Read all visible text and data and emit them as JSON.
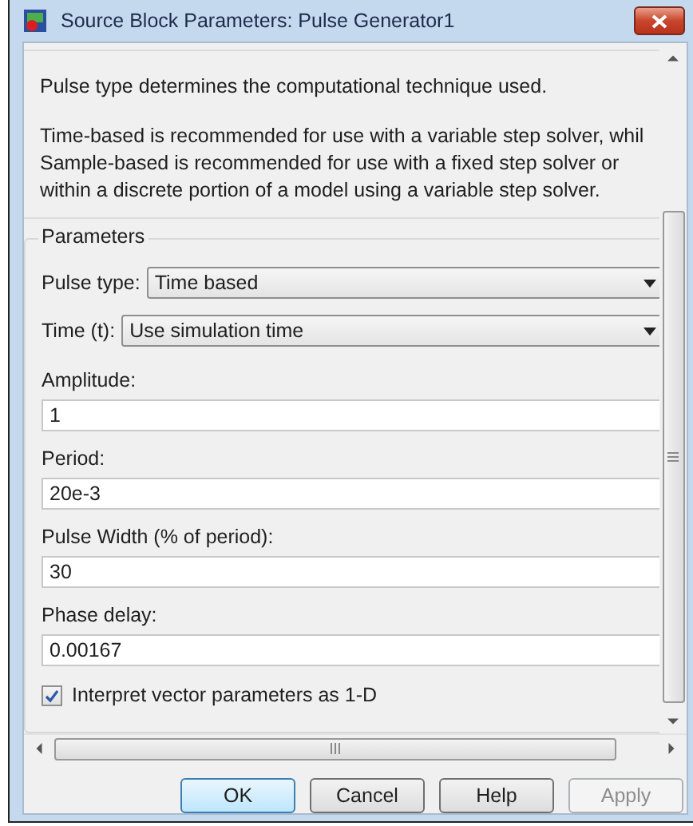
{
  "window": {
    "title": "Source Block Parameters: Pulse Generator1"
  },
  "description": [
    "Pulse type determines the computational technique used.",
    "Time-based is recommended for use with a variable step solver, whil\nSample-based is recommended for use with a fixed step solver or\nwithin a discrete portion of a model using a variable step solver."
  ],
  "parameters": {
    "title": "Parameters",
    "items": [
      {
        "kind": "select",
        "label": "Pulse type:",
        "value": "Time based"
      },
      {
        "kind": "select",
        "label": "Time (t):",
        "value": "Use simulation time"
      },
      {
        "kind": "text",
        "label": "Amplitude:",
        "value": "1"
      },
      {
        "kind": "text",
        "label": "Period:",
        "value": "20e-3"
      },
      {
        "kind": "text",
        "label": "Pulse Width (% of period):",
        "value": "30"
      },
      {
        "kind": "text",
        "label": "Phase delay:",
        "value": "0.00167"
      },
      {
        "kind": "checkbox",
        "label": "Interpret vector parameters as 1-D",
        "checked": true
      }
    ]
  },
  "buttons": [
    {
      "label": "OK",
      "default": true,
      "disabled": false
    },
    {
      "label": "Cancel",
      "default": false,
      "disabled": false
    },
    {
      "label": "Help",
      "default": false,
      "disabled": false
    },
    {
      "label": "Apply",
      "default": false,
      "disabled": true
    }
  ]
}
